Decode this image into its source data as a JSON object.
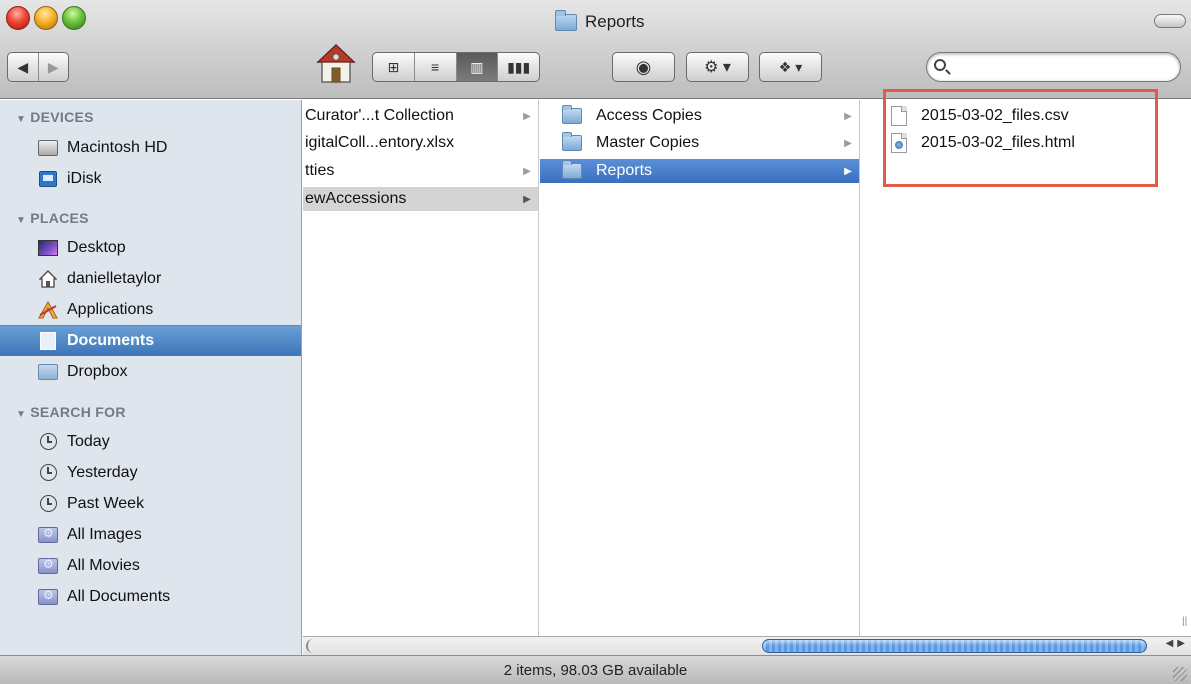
{
  "window": {
    "title": "Reports",
    "icons": {
      "close": "close-button",
      "minimize": "minimize-button",
      "zoom": "zoom-button"
    }
  },
  "toolbar": {
    "back_icon": "back-arrow-icon",
    "forward_icon": "forward-arrow-icon",
    "home_icon": "home-icon",
    "view_modes": [
      "icon-view-icon",
      "list-view-icon",
      "column-view-icon",
      "cover-flow-icon"
    ],
    "active_view": "column-view-icon",
    "quick_look_icon": "eye-icon",
    "action_icon": "gear-icon",
    "dropbox_icon": "dropbox-icon",
    "search_placeholder": ""
  },
  "sidebar": {
    "sections": [
      {
        "header": "DEVICES",
        "items": [
          {
            "label": "Macintosh HD",
            "icon": "hard-drive-icon"
          },
          {
            "label": "iDisk",
            "icon": "idisk-icon"
          }
        ]
      },
      {
        "header": "PLACES",
        "items": [
          {
            "label": "Desktop",
            "icon": "desktop-icon"
          },
          {
            "label": "danielletaylor",
            "icon": "home-icon"
          },
          {
            "label": "Applications",
            "icon": "applications-icon"
          },
          {
            "label": "Documents",
            "icon": "documents-icon",
            "selected": true
          },
          {
            "label": "Dropbox",
            "icon": "dropbox-folder-icon"
          }
        ]
      },
      {
        "header": "SEARCH FOR",
        "items": [
          {
            "label": "Today",
            "icon": "clock-icon"
          },
          {
            "label": "Yesterday",
            "icon": "clock-icon"
          },
          {
            "label": "Past Week",
            "icon": "clock-icon"
          },
          {
            "label": "All Images",
            "icon": "smart-folder-icon"
          },
          {
            "label": "All Movies",
            "icon": "smart-folder-icon"
          },
          {
            "label": "All Documents",
            "icon": "smart-folder-icon"
          }
        ]
      }
    ]
  },
  "columns": {
    "col1": [
      {
        "label": "Curator'...t Collection",
        "has_children": true
      },
      {
        "label": "igitalColl...entory.xlsx",
        "has_children": false
      },
      {
        "label": "tties",
        "has_children": true
      },
      {
        "label": "ewAccessions",
        "has_children": true,
        "state": "gray"
      }
    ],
    "col2": [
      {
        "label": "Access Copies",
        "has_children": true
      },
      {
        "label": "Master Copies",
        "has_children": true
      },
      {
        "label": "Reports",
        "has_children": true,
        "state": "blue"
      }
    ],
    "col3": [
      {
        "label": "2015-03-02_files.csv",
        "type": "csv"
      },
      {
        "label": "2015-03-02_files.html",
        "type": "html"
      }
    ]
  },
  "status": {
    "text": "2 items, 98.03 GB available"
  },
  "colors": {
    "selection": "#3d74b8",
    "highlight_box": "#e35b48",
    "sidebar_bg": "#dfe5ed"
  }
}
